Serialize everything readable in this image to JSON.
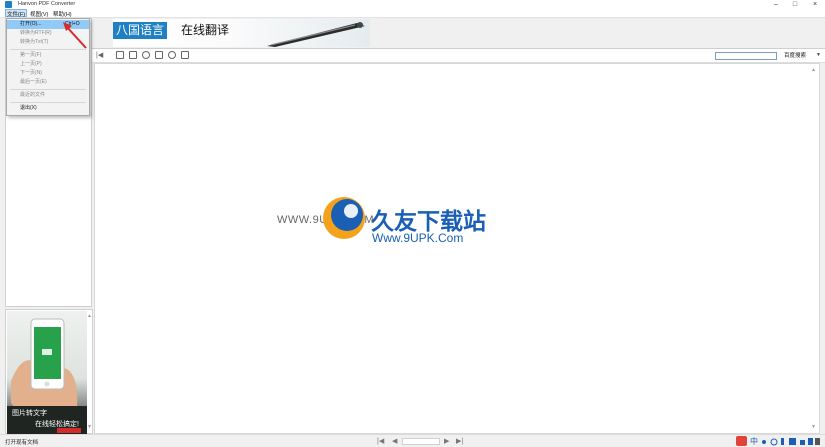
{
  "app": {
    "title": "Hanvon PDF Converter"
  },
  "menu": {
    "file": "文件(F)",
    "view": "视图(V)",
    "help": "帮助(H)"
  },
  "file_menu": {
    "open": "打开(O)...",
    "open_shortcut": "Ctrl+O",
    "convert_rtf": "转换为RTF(R)",
    "convert_txt": "转换为Txt(T)",
    "first_page": "第一页(F)",
    "prev_page": "上一页(P)",
    "next_page": "下一页(N)",
    "last_page": "最后一页(E)",
    "recent": "最近的文件",
    "exit": "退出(X)"
  },
  "banner": {
    "highlight": "八国语言",
    "text": "在线翻译"
  },
  "toolbar": {
    "search_button": "百度搜索"
  },
  "watermark": {
    "site": "WWW.9UPK.COM",
    "brand": "久友下载站",
    "url": "Www.9UPK.Com"
  },
  "thumbnail": {
    "line1": "图片转文字",
    "line2": "在线轻松搞定!"
  },
  "statusbar": {
    "text": "打开现有文档"
  },
  "colors": {
    "highlight": "#91c9f7",
    "banner_blue": "#1f80c3",
    "logo_blue": "#1a5fb4",
    "logo_orange": "#f5a21b",
    "arrow_red": "#d42a2a"
  }
}
